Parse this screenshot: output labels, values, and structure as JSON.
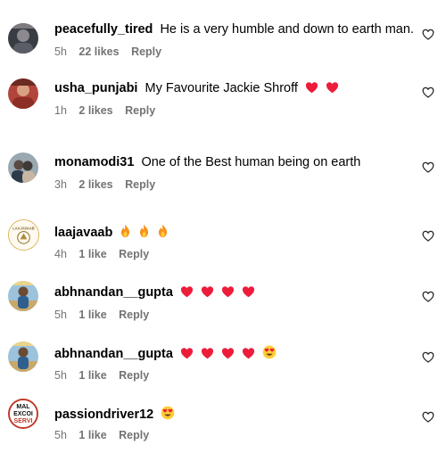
{
  "comments": [
    {
      "username": "peacefully_tired",
      "text": "He is a very humble and down to earth man.",
      "emojis": [],
      "time": "5h",
      "likes": "22 likes",
      "reply": "Reply",
      "avatar_icon": "avatar-photo-dark"
    },
    {
      "username": "usha_punjabi",
      "text": "My Favourite Jackie Shroff",
      "emojis": [
        "red-heart",
        "red-heart"
      ],
      "time": "1h",
      "likes": "2 likes",
      "reply": "Reply",
      "avatar_icon": "avatar-photo-red"
    },
    {
      "username": "monamodi31",
      "text": "One of the Best human being on earth",
      "emojis": [],
      "time": "3h",
      "likes": "2 likes",
      "reply": "Reply",
      "avatar_icon": "avatar-photo-couple"
    },
    {
      "username": "laajavaab",
      "text": "",
      "emojis": [
        "fire",
        "fire",
        "fire"
      ],
      "time": "4h",
      "likes": "1 like",
      "reply": "Reply",
      "avatar_icon": "avatar-logo-laajavaab"
    },
    {
      "username": "abhnandan__gupta",
      "text": "",
      "emojis": [
        "red-heart",
        "red-heart",
        "red-heart",
        "red-heart"
      ],
      "time": "5h",
      "likes": "1 like",
      "reply": "Reply",
      "avatar_icon": "avatar-photo-outdoor"
    },
    {
      "username": "abhnandan__gupta",
      "text": "",
      "emojis": [
        "red-heart",
        "red-heart",
        "red-heart",
        "red-heart",
        "heart-eyes-face"
      ],
      "time": "5h",
      "likes": "1 like",
      "reply": "Reply",
      "avatar_icon": "avatar-photo-outdoor"
    },
    {
      "username": "passiondriver12",
      "text": "",
      "emojis": [
        "heart-eyes-face"
      ],
      "time": "5h",
      "likes": "1 like",
      "reply": "Reply",
      "avatar_icon": "avatar-logo-malexcoi"
    }
  ],
  "avatar_logo_text": {
    "laajavaab": "LAAJAVAAB",
    "malexcoi": [
      "MAL",
      "EXCOI",
      "SERVI"
    ]
  },
  "colors": {
    "secondary_text": "#737373",
    "heart": "#ed1c3a",
    "fire": "#f7931e"
  }
}
